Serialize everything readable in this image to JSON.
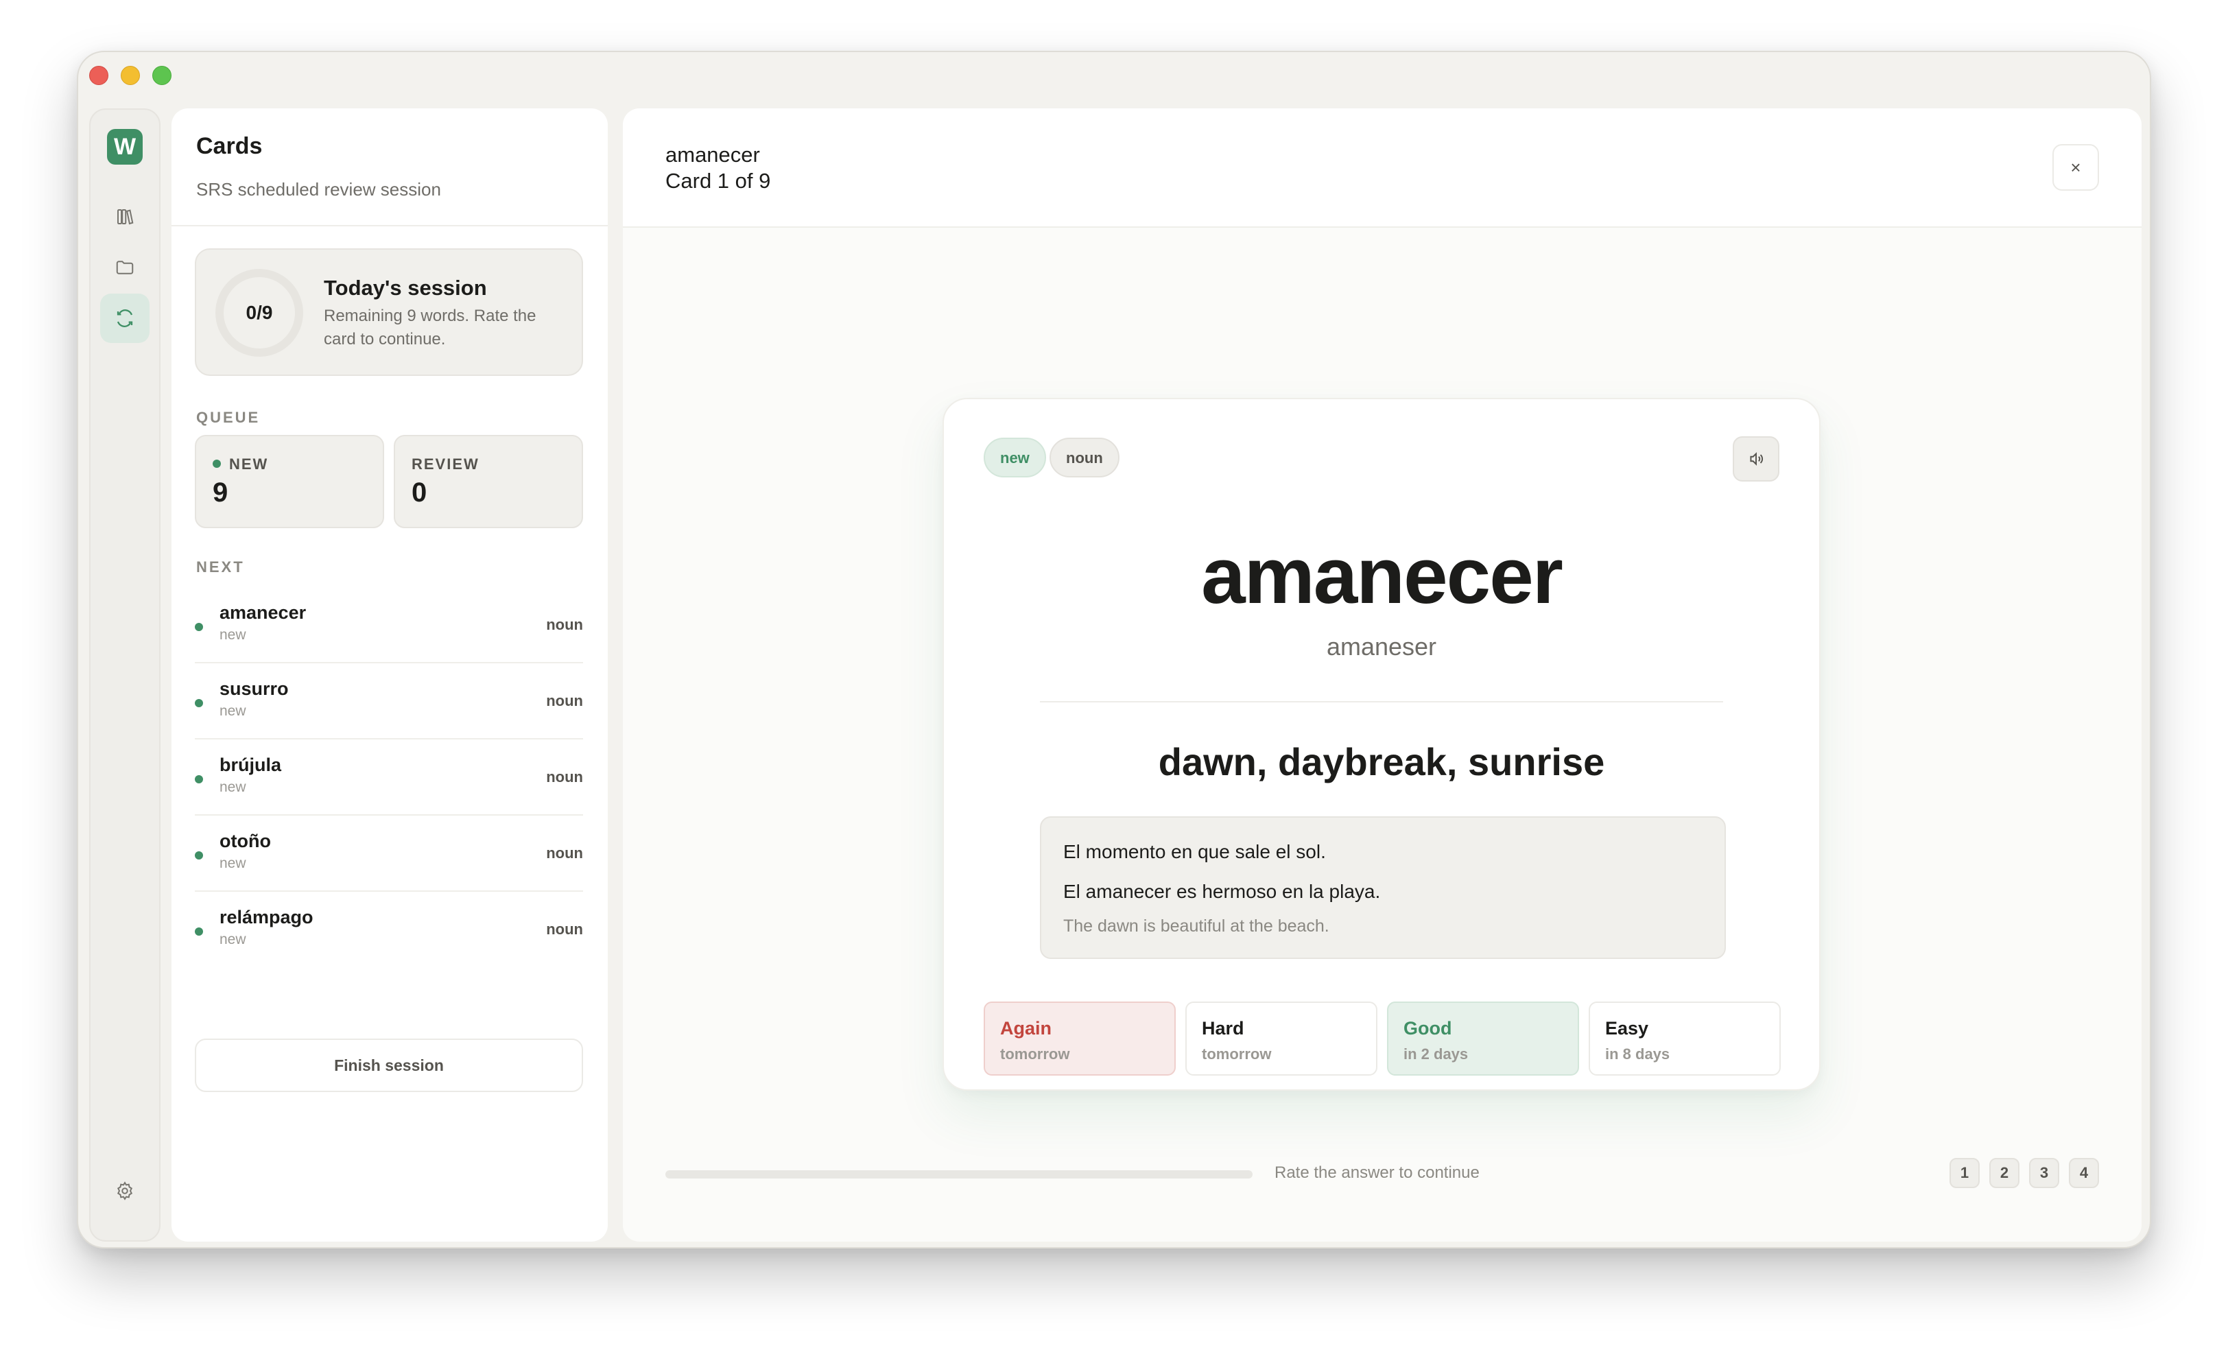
{
  "app": {
    "logo_letter": "W",
    "accent": "#3f8f65"
  },
  "rail": {
    "icons": [
      "library-icon",
      "folder-icon",
      "review-icon",
      "settings-icon"
    ]
  },
  "panel": {
    "title": "Cards",
    "subtitle": "SRS scheduled review session",
    "session": {
      "progress": "0/9",
      "title": "Today's session",
      "description": "Remaining 9 words. Rate the card to continue."
    },
    "queue_label": "QUEUE",
    "queue": {
      "new": {
        "label": "NEW",
        "value": "9"
      },
      "review": {
        "label": "REVIEW",
        "value": "0"
      }
    },
    "next_label": "NEXT",
    "next": [
      {
        "word": "amanecer",
        "status": "new",
        "pos": "noun"
      },
      {
        "word": "susurro",
        "status": "new",
        "pos": "noun"
      },
      {
        "word": "brújula",
        "status": "new",
        "pos": "noun"
      },
      {
        "word": "otoño",
        "status": "new",
        "pos": "noun"
      },
      {
        "word": "relámpago",
        "status": "new",
        "pos": "noun"
      }
    ],
    "finish_label": "Finish session"
  },
  "main": {
    "title": "amanecer",
    "counter": "Card 1 of 9",
    "close_label": "×",
    "card": {
      "tags": {
        "status": "new",
        "pos": "noun"
      },
      "word": "amanecer",
      "phonetic": "amaneser",
      "translation": "dawn, daybreak, sunrise",
      "definition": "El momento en que sale el sol.",
      "example": "El amanecer es hermoso en la playa.",
      "example_translation": "The dawn is beautiful at the beach."
    },
    "ratings": [
      {
        "label": "Again",
        "when": "tomorrow"
      },
      {
        "label": "Hard",
        "when": "tomorrow"
      },
      {
        "label": "Good",
        "when": "in 2 days"
      },
      {
        "label": "Easy",
        "when": "in 8 days"
      }
    ],
    "progress_fraction": 0,
    "hint": "Rate the answer to continue",
    "shortcut_keys": [
      "1",
      "2",
      "3",
      "4"
    ]
  }
}
